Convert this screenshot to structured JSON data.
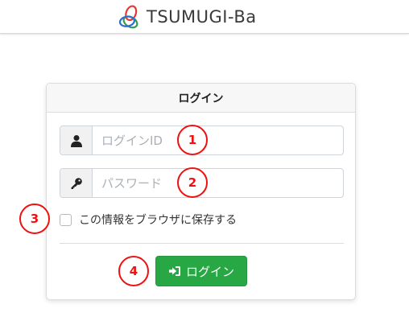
{
  "header": {
    "brand": "TSUMUGI-Ba"
  },
  "card": {
    "title": "ログイン",
    "login_id": {
      "value": "",
      "placeholder": "ログインID"
    },
    "password": {
      "value": "",
      "placeholder": "パスワード"
    },
    "remember_label": "この情報をブラウザに保存する",
    "remember_checked": false,
    "login_button": "ログイン"
  },
  "markers": [
    "1",
    "2",
    "3",
    "4"
  ],
  "colors": {
    "button": "#28a745",
    "marker": "#e11111"
  },
  "icons": {
    "user": "user-icon",
    "key": "key-icon",
    "signin": "sign-in-icon",
    "logo": "logo-mark-icon"
  }
}
